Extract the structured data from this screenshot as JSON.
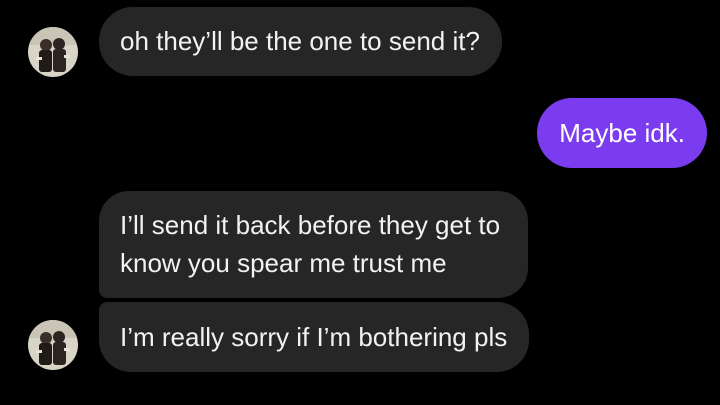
{
  "conversation": {
    "messages": [
      {
        "sender": "them",
        "text": "oh they’ll be the one to send it?"
      },
      {
        "sender": "me",
        "text": "Maybe idk."
      },
      {
        "sender": "them",
        "lines": [
          "I’ll send it back before they get to",
          "know you spear me trust me"
        ]
      },
      {
        "sender": "them",
        "text": "I’m really sorry if I’m bothering pls"
      }
    ]
  },
  "avatar": {
    "icon": "contact-photo"
  },
  "colors": {
    "background": "#000000",
    "incoming_bubble": "#262626",
    "outgoing_bubble": "#7b3cf0",
    "text": "#ffffff"
  }
}
